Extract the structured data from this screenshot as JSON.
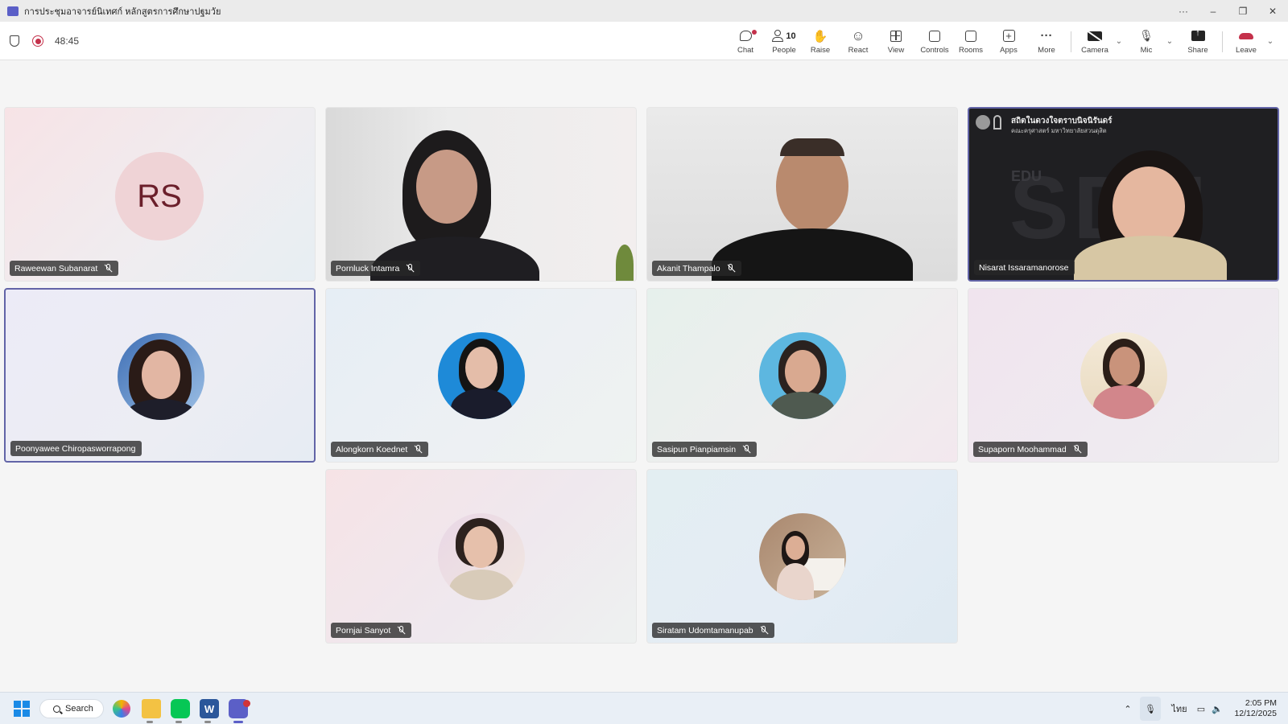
{
  "window": {
    "title": "การประชุมอาจารย์นิเทศก์ หลักสูตรการศึกษาปฐมวัย",
    "controls": {
      "more": "···",
      "minimize": "–",
      "restore": "❐",
      "close": "✕"
    }
  },
  "toolbar": {
    "timer": "48:45",
    "buttons": {
      "chat": "Chat",
      "people": "People",
      "people_count": "10",
      "raise": "Raise",
      "react": "React",
      "view": "View",
      "controls": "Controls",
      "rooms": "Rooms",
      "apps": "Apps",
      "more": "More",
      "camera": "Camera",
      "mic": "Mic",
      "share": "Share",
      "leave": "Leave"
    },
    "icons": [
      "shield-icon",
      "recording-icon",
      "chat-icon",
      "people-icon",
      "hand-icon",
      "smile-icon",
      "grid-icon",
      "controls-icon",
      "rooms-icon",
      "apps-icon",
      "ellipsis-icon",
      "camera-off-icon",
      "mic-off-icon",
      "share-icon",
      "phone-hangup-icon"
    ]
  },
  "participants": [
    {
      "name": "Raweewan Subanarat",
      "initials": "RS",
      "muted": true
    },
    {
      "name": "Pornluck Intamra",
      "muted": true
    },
    {
      "name": "Akanit Thampalo",
      "muted": true
    },
    {
      "name": "Nisarat Issaramanorose",
      "muted": false,
      "banner": "สถิตในดวงใจตราบนิจนิรันดร์",
      "banner_sub": "คณะครุศาสตร์ มหาวิทยาลัยสวนดุสิต",
      "bg_text": "SDU",
      "bg_text_small": "EDU"
    },
    {
      "name": "Poonyawee Chiropasworrapong",
      "muted": false
    },
    {
      "name": "Alongkorn Koednet",
      "muted": true
    },
    {
      "name": "Sasipun Pianpiamsin",
      "muted": true
    },
    {
      "name": "Supaporn Moohammad",
      "muted": true
    },
    {
      "name": "Pornjai Sanyot",
      "muted": true
    },
    {
      "name": "Siratam Udomtamanupab",
      "muted": true
    }
  ],
  "taskbar": {
    "search": "Search",
    "language": "ไทย",
    "time": "2:05 PM",
    "date": "12/12/2025",
    "colors": {
      "accent": "#1a8ae6",
      "brand": "#5b5fc7",
      "leave": "#c4314b"
    }
  }
}
